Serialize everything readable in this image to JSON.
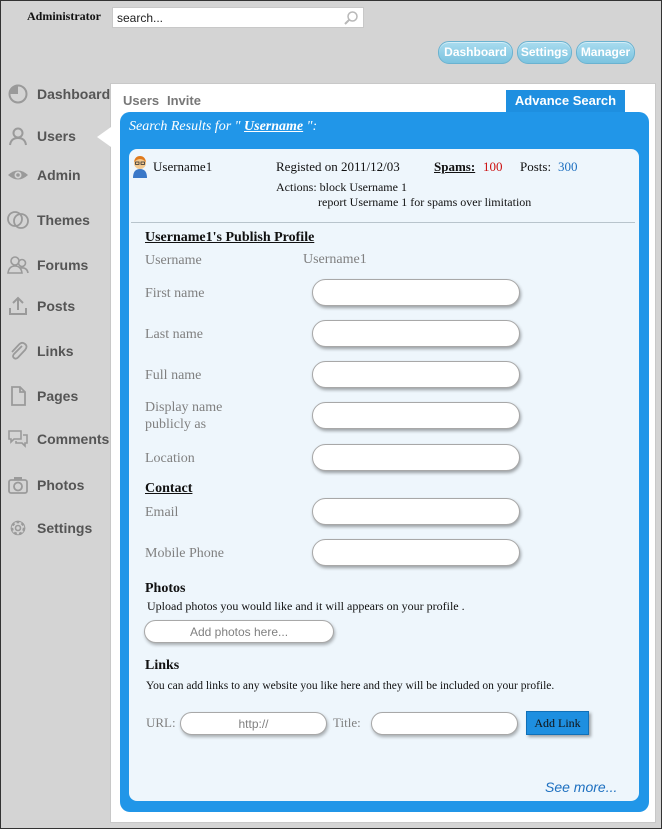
{
  "header": {
    "admin_label": "Administrator",
    "search_value": "search...",
    "buttons": [
      "Dashboard",
      "Settings",
      "Manager"
    ]
  },
  "sidebar": {
    "items": [
      {
        "label": "Dashboard",
        "icon": "dashboard-icon"
      },
      {
        "label": "Users",
        "icon": "user-icon"
      },
      {
        "label": "Admin",
        "icon": "eye-icon"
      },
      {
        "label": "Themes",
        "icon": "themes-icon"
      },
      {
        "label": "Forums",
        "icon": "forums-icon"
      },
      {
        "label": "Posts",
        "icon": "upload-icon"
      },
      {
        "label": "Links",
        "icon": "paperclip-icon"
      },
      {
        "label": "Pages",
        "icon": "page-icon"
      },
      {
        "label": "Comments",
        "icon": "comments-icon"
      },
      {
        "label": "Photos",
        "icon": "camera-icon"
      },
      {
        "label": "Settings",
        "icon": "gear-icon"
      }
    ]
  },
  "main": {
    "tabs": [
      "Users",
      "Invite"
    ],
    "advance_search": "Advance Search",
    "results_prefix": "Search Results for \" ",
    "results_term": "Username",
    "results_suffix": " \":",
    "user": {
      "name": "Username1",
      "registered": "Registed on 2011/12/03",
      "spams_label": "Spams:",
      "spams_value": "100",
      "posts_label": "Posts:",
      "posts_value": "300",
      "actions_line1": "Actions: block Username 1",
      "actions_line2": "report Username 1 for spams over limitation"
    },
    "profile": {
      "title": "Username1's Publish Profile",
      "username_label": "Username",
      "username_value": "Username1",
      "first_name": "First name",
      "last_name": "Last name",
      "full_name": "Full name",
      "display_name_1": "Display name",
      "display_name_2": "publicly as",
      "location": "Location"
    },
    "contact": {
      "title": "Contact",
      "email": "Email",
      "mobile": "Mobile Phone"
    },
    "photos": {
      "title": "Photos",
      "desc": "Upload photos you would like and it will appears  on your profile .",
      "placeholder": "Add photos here..."
    },
    "links": {
      "title": "Links",
      "desc": "You can add links to any website you like here and they will be included on your profile.",
      "url_label": "URL:",
      "url_placeholder": "http://",
      "title_label": "Title:",
      "add_button": "Add Link"
    },
    "see_more": "See more..."
  },
  "colors": {
    "accent": "#2196e8",
    "spam_red": "#cc1111",
    "posts_blue": "#1e70c0"
  }
}
